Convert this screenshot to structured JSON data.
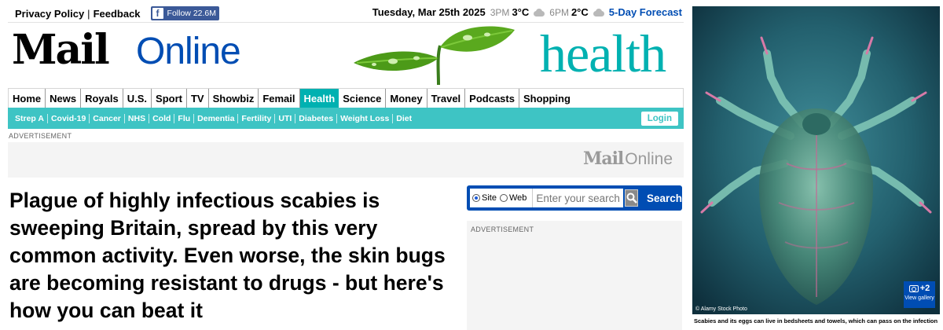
{
  "topbar": {
    "privacy": "Privacy Policy",
    "feedback": "Feedback",
    "follow_label": "Follow",
    "follow_count": "22.6M",
    "date": "Tuesday, Mar 25th 2025",
    "weather": [
      {
        "time": "3PM",
        "temp": "3°C",
        "icon": "cloud-icon"
      },
      {
        "time": "6PM",
        "temp": "2°C",
        "icon": "cloud-icon"
      }
    ],
    "forecast_link": "5-Day Forecast"
  },
  "masthead": {
    "logo_mail": "Mail",
    "logo_online": "Online",
    "section": "health",
    "brand_color": "#004db3",
    "section_color": "#00b1b1"
  },
  "nav": {
    "items": [
      "Home",
      "News",
      "Royals",
      "U.S.",
      "Sport",
      "TV",
      "Showbiz",
      "Femail",
      "Health",
      "Science",
      "Money",
      "Travel",
      "Podcasts",
      "Shopping"
    ],
    "active": "Health"
  },
  "subnav": {
    "items": [
      "Strep A",
      "Covid-19",
      "Cancer",
      "NHS",
      "Cold",
      "Flu",
      "Dementia",
      "Fertility",
      "UTI",
      "Diabetes",
      "Weight Loss",
      "Diet"
    ],
    "login": "Login"
  },
  "ad": {
    "label": "ADVERTISEMENT",
    "logo_mail": "Mail",
    "logo_online": "Online"
  },
  "article": {
    "headline": "Plague of highly infectious scabies is sweeping Britain, spread by this very common activity. Even worse, the skin bugs are becoming resistant to drugs - but here's how you can beat it"
  },
  "search": {
    "site_label": "Site",
    "web_label": "Web",
    "selected": "Site",
    "placeholder": "Enter your search",
    "button": "Search"
  },
  "side_ad": {
    "label": "ADVERTISEMENT"
  },
  "photo": {
    "credit": "© Alamy Stock Photo",
    "gallery_count": "+2",
    "gallery_label": "View gallery",
    "caption": "Scabies and its eggs can live in bedsheets and towels, which can pass on the infection"
  }
}
